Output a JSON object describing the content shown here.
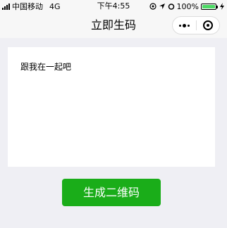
{
  "status_bar": {
    "carrier": "中国移动",
    "network": "4G",
    "time": "下午4:55",
    "battery_percent": "100%",
    "icons": [
      "signal-icon",
      "location-icon",
      "alarm-icon",
      "battery-icon",
      "charging-icon"
    ]
  },
  "nav": {
    "title": "立即生码",
    "capsule_icons": [
      "more-icon",
      "close-mini-program-icon"
    ]
  },
  "editor": {
    "text": "跟我在一起吧"
  },
  "action": {
    "button_label": "生成二维码"
  },
  "colors": {
    "background": "#efeff4",
    "primary_button": "#1aad19",
    "battery": "#4cd964"
  }
}
